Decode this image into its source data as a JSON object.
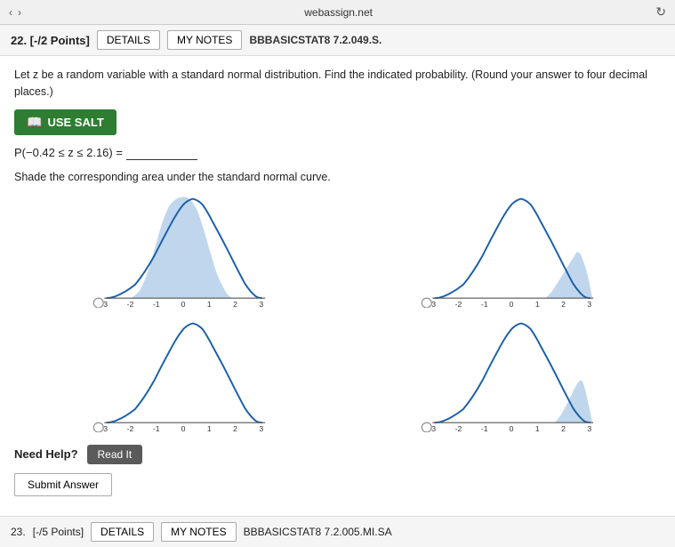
{
  "browser": {
    "nav_back": "‹",
    "nav_forward": "›",
    "url": "webassign.net",
    "url_label": "webassign.net"
  },
  "header": {
    "question_number": "22. [-/2 Points]",
    "details_label": "DETAILS",
    "mynotes_label": "MY NOTES",
    "code": "BBBASICSTAT8 7.2.049.S."
  },
  "content": {
    "instruction": "Let z be a random variable with a standard normal distribution. Find the indicated probability. (Round your answer to four decimal places.)",
    "use_salt_label": "USE SALT",
    "probability_label": "P(−0.42 ≤ z ≤ 2.16) =",
    "probability_value": "",
    "shade_instruction": "Shade the corresponding area under the standard normal curve.",
    "x_axis_labels": [
      "-3",
      "-2",
      "-1",
      "0",
      "1",
      "2",
      "3"
    ]
  },
  "help": {
    "need_help_label": "Need Help?",
    "read_it_label": "Read It"
  },
  "actions": {
    "submit_label": "Submit Answer"
  },
  "next_question": {
    "number": "23.",
    "points": "[-/5 Points]",
    "details_label": "DETAILS",
    "mynotes_label": "MY NOTES",
    "code": "BBBASICSTAT8 7.2.005.MI.SA"
  },
  "colors": {
    "salt_btn": "#2e7d32",
    "curve_fill": "#b0cce8",
    "curve_stroke": "#1a5fa8",
    "axis_color": "#555"
  }
}
